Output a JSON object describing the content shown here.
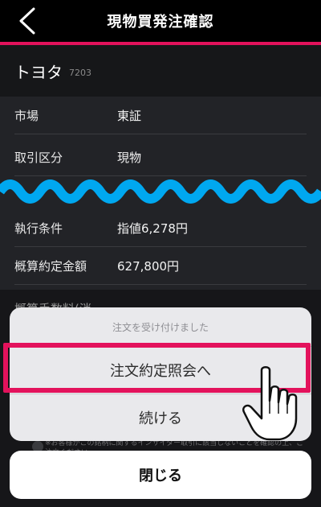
{
  "nav": {
    "title": "現物買発注確認",
    "back_icon": "chevron-left-icon"
  },
  "stock": {
    "name": "トヨタ",
    "code": "7203"
  },
  "details": [
    {
      "label": "市場",
      "value": "東証"
    },
    {
      "label": "取引区分",
      "value": "現物"
    },
    {
      "label": "執行条件",
      "value": "指値6,278円"
    },
    {
      "label": "概算約定金額",
      "value": "627,800円"
    },
    {
      "label": "概算手数料(消",
      "value": ""
    }
  ],
  "sheet": {
    "message": "注文を受け付けました",
    "primary_label": "注文約定照会へ",
    "secondary_label": "続ける"
  },
  "disclaimer": "※お客様がこの銘柄に関するインサイダー取引に該当しないことを確認の上、ご注文ください。",
  "close_label": "閉じる",
  "colors": {
    "accent": "#e3125c",
    "wave": "#00a8f0"
  }
}
